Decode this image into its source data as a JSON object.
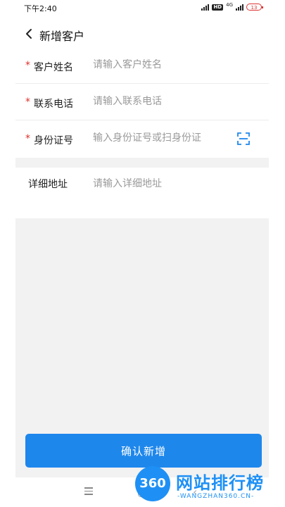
{
  "status_bar": {
    "time": "下午2:40",
    "network": "4G",
    "hd": "HD",
    "battery": "13"
  },
  "header": {
    "title": "新增客户"
  },
  "form": {
    "fields": [
      {
        "label": "客户姓名",
        "required": true,
        "placeholder": "请输入客户姓名",
        "value": ""
      },
      {
        "label": "联系电话",
        "required": true,
        "placeholder": "请输入联系电话",
        "value": ""
      },
      {
        "label": "身份证号",
        "required": true,
        "placeholder": "输入身份证号或扫身份证",
        "value": "",
        "icon": "scan-icon"
      },
      {
        "label": "详细地址",
        "required": false,
        "placeholder": "请输入详细地址",
        "value": ""
      }
    ],
    "required_mark": "*"
  },
  "actions": {
    "confirm_label": "确认新增"
  },
  "watermark": {
    "logo_text": "360",
    "brand": "网站排行榜",
    "url": "-WANGZHAN360.CN-"
  },
  "colors": {
    "accent": "#1e87ec",
    "required": "#e0302a",
    "background_grey": "#f2f2f2"
  }
}
